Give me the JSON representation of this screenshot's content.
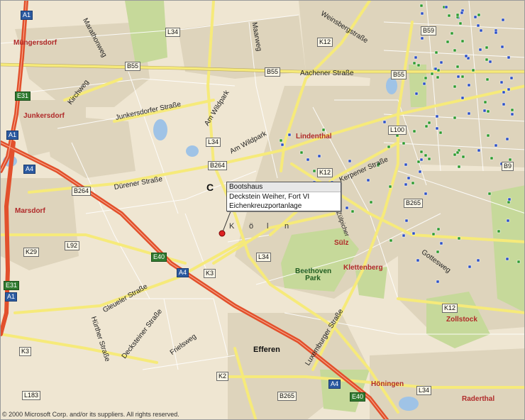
{
  "map": {
    "copyright": "© 2000 Microsoft Corp. and/or its suppliers. All rights reserved.",
    "marker_letter": "C",
    "callout": {
      "title": "Bootshaus",
      "line1": "Deckstein Weiher, Fort VI",
      "line2": "Eichenkreuzportanlage"
    },
    "places": {
      "mungersdorf": "Müngersdorf",
      "junkersdorf": "Junkersdorf",
      "marsdorf": "Marsdorf",
      "lindenthal": "Lindenthal",
      "sulz": "Sülz",
      "klettenberg": "Klettenberg",
      "zollstock": "Zollstock",
      "raderthal": "Raderthal",
      "honingen": "Höningen",
      "efferen": "Efferen",
      "beethoven_park": "Beethoven Park",
      "koln_letters": [
        "K",
        "ö",
        "l",
        "n"
      ]
    },
    "streets": {
      "aachener": "Aachener Straße",
      "weinsberg": "Weinsbergstraße",
      "dueren": "Dürener Straße",
      "junkersdorfer": "Junkersdorfer Straße",
      "am_wildpark_1": "Am Wildpark",
      "am_wildpark_2": "Am Wildpark",
      "kirchweg": "Kirchweg",
      "marathonweg": "Marathonweg",
      "maarweg": "Maarweg",
      "kerpener": "Kerpener Straße",
      "gottesweg": "Gottesweg",
      "gleueler": "Gleueler Straße",
      "hurther": "Hürther Straße",
      "decksteiner": "Decksteiner Straße",
      "frieslweg": "Frielsweg",
      "luxemburger": "Luxemburger Straße",
      "zuelpicher": "Zülpicher"
    },
    "shields": {
      "a1_top": "A1",
      "a1_mid": "A1",
      "a1_low": "A1",
      "e31_top": "E31",
      "e31_low": "E31",
      "a4_left": "A4",
      "a4_mid": "A4",
      "a4_bottom": "A4",
      "e40_mid": "E40",
      "e40_bottom": "E40",
      "l34_top": "L34",
      "l34_mid": "L34",
      "l34_low": "L34",
      "l34_bottom": "L34",
      "b55_left": "B55",
      "b55_mid": "B55",
      "b55_right": "B55",
      "k12_top": "K12",
      "k12_mid": "K12",
      "k12_low": "K12",
      "b59": "B59",
      "l100": "L100",
      "b9": "B9",
      "b264_left": "B264",
      "b264_mid": "B264",
      "b265_right": "B265",
      "b265_bottom": "B265",
      "k29": "K29",
      "l92": "L92",
      "k3_mid": "K3",
      "k3_left": "K3",
      "k2": "K2",
      "l183": "L183"
    },
    "colors": {
      "land": "#efe6d2",
      "urban": "#ded4bc",
      "park": "#c6d99a",
      "water": "#9fc3e6",
      "highway": "#e2502c",
      "main_road": "#f6ea7a",
      "minor_road": "#ffffff",
      "place_red": "#b02a2a"
    }
  }
}
